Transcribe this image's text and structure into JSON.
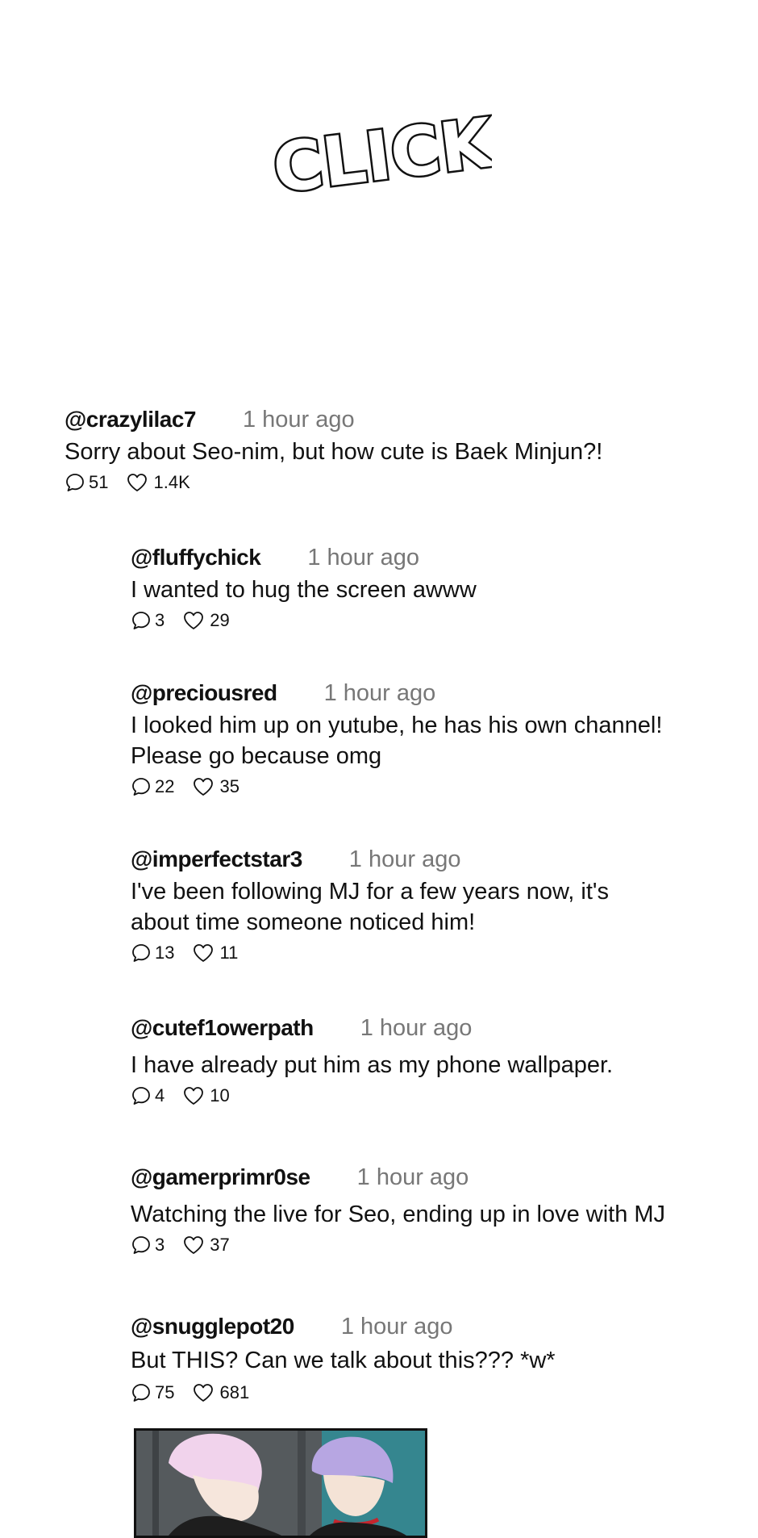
{
  "sfx_text": "CLICK",
  "comments": [
    {
      "handle": "@crazylilac7",
      "time": "1 hour ago",
      "lines": [
        "Sorry about Seo-nim, but how cute is Baek Minjun?!"
      ],
      "replies": "51",
      "likes": "1.4K"
    },
    {
      "handle": "@fluffychick",
      "time": "1 hour ago",
      "lines": [
        "I wanted to hug the screen awww"
      ],
      "replies": "3",
      "likes": "29"
    },
    {
      "handle": "@preciousred",
      "time": "1 hour ago",
      "lines": [
        "I looked him up on yutube, he has his own channel!",
        "Please go because omg"
      ],
      "replies": "22",
      "likes": "35"
    },
    {
      "handle": "@imperfectstar3",
      "time": "1 hour ago",
      "lines": [
        "I've been following MJ for a few years now, it's",
        "about time someone noticed him!"
      ],
      "replies": "13",
      "likes": "11"
    },
    {
      "handle": "@cutef1owerpath",
      "time": "1 hour ago",
      "lines": [
        "I have already put him as my phone wallpaper."
      ],
      "replies": "4",
      "likes": "10"
    },
    {
      "handle": "@gamerprimr0se",
      "time": "1 hour ago",
      "lines": [
        "Watching the live for Seo, ending up in love with MJ"
      ],
      "replies": "3",
      "likes": "37"
    },
    {
      "handle": "@snugglepot20",
      "time": "1 hour ago",
      "lines": [
        "But THIS? Can we talk about this??? *w*"
      ],
      "replies": "75",
      "likes": "681"
    }
  ],
  "icons": {
    "reply": "speech-bubble-icon",
    "like": "heart-icon"
  },
  "colors": {
    "text": "#111111",
    "timestamp": "#777777",
    "panel_teal": "#3b8d96"
  }
}
